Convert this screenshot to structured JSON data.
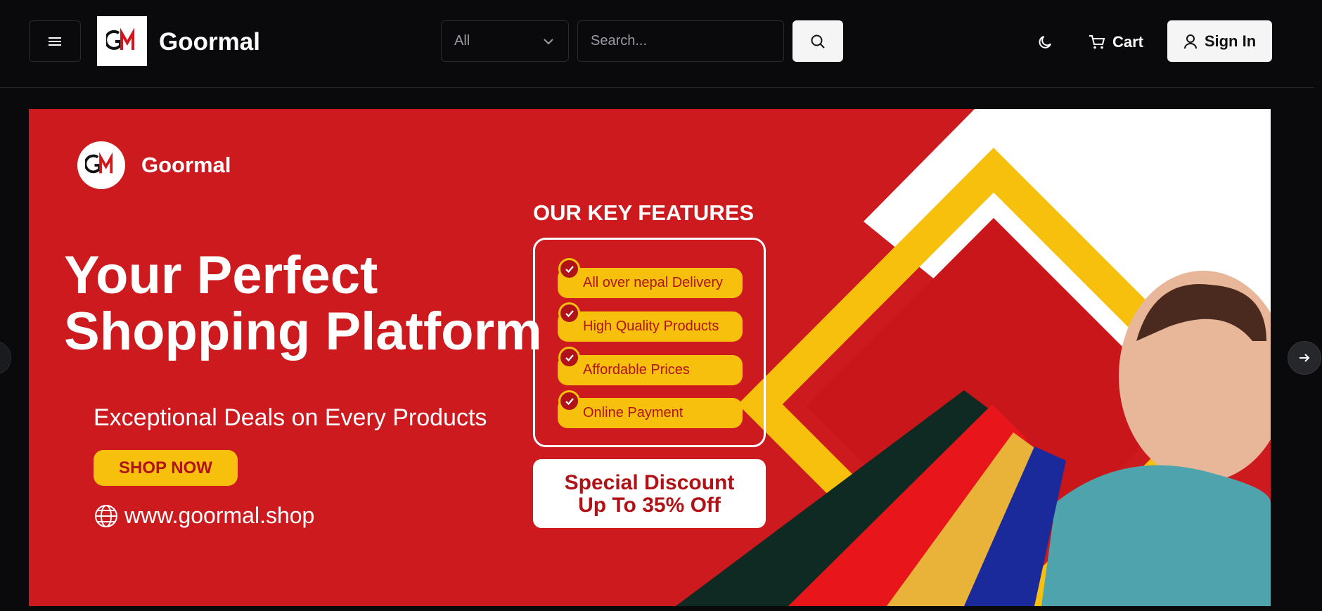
{
  "header": {
    "menu_icon": "hamburger-icon",
    "logo_text": "GM",
    "brand": "Goormal",
    "category_select": {
      "selected": "All",
      "icon": "chevron-down-icon"
    },
    "search": {
      "placeholder": "Search...",
      "value": ""
    },
    "search_icon": "search-icon",
    "theme_icon": "moon-icon",
    "cart_label": "Cart",
    "cart_icon": "cart-icon",
    "signin_label": "Sign In",
    "signin_icon": "user-icon"
  },
  "banner": {
    "logo_text": "GM",
    "brand": "Goormal",
    "headline_line1": "Your Perfect",
    "headline_line2": "Shopping Platform",
    "subline": "Exceptional Deals on Every Products",
    "shop_button": "SHOP NOW",
    "website": "www.goormal.shop",
    "website_icon": "globe-icon",
    "features_title": "OUR KEY FEATURES",
    "features": [
      "All over nepal Delivery",
      "High Quality Products",
      "Affordable Prices",
      "Online Payment"
    ],
    "discount_line1": "Special Discount",
    "discount_line2": "Up To 35% Off",
    "colors": {
      "red": "#cc1a1e",
      "yellow": "#f7c00c",
      "white": "#ffffff"
    }
  },
  "carousel": {
    "prev_icon": "arrow-left-icon",
    "next_icon": "arrow-right-icon"
  }
}
